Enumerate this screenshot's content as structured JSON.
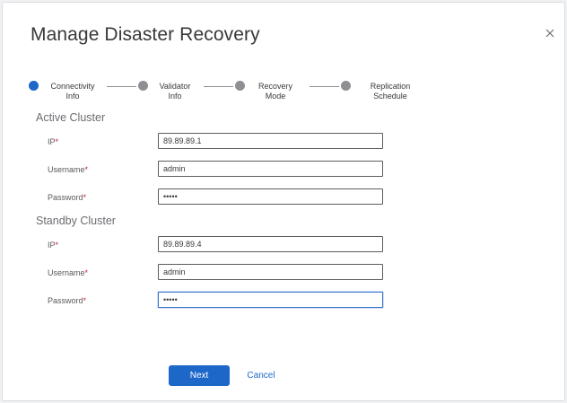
{
  "dialog": {
    "title": "Manage Disaster Recovery"
  },
  "stepper": {
    "steps": [
      {
        "line1": "Connectivity",
        "line2": "Info",
        "active": true
      },
      {
        "line1": "Validator",
        "line2": "Info",
        "active": false
      },
      {
        "line1": "Recovery",
        "line2": "Mode",
        "active": false
      },
      {
        "line1": "Replication",
        "line2": "Schedule",
        "active": false
      }
    ]
  },
  "active_cluster": {
    "title": "Active Cluster",
    "ip_label": "IP",
    "ip_value": "89.89.89.1",
    "username_label": "Username",
    "username_value": "admin",
    "password_label": "Password",
    "password_value": "admin"
  },
  "standby_cluster": {
    "title": "Standby Cluster",
    "ip_label": "IP",
    "ip_value": "89.89.89.4",
    "username_label": "Username",
    "username_value": "admin",
    "password_label": "Password",
    "password_value": "admin"
  },
  "required_marker": "*",
  "footer": {
    "next_label": "Next",
    "cancel_label": "Cancel"
  },
  "icons": {
    "close": "close-icon"
  }
}
